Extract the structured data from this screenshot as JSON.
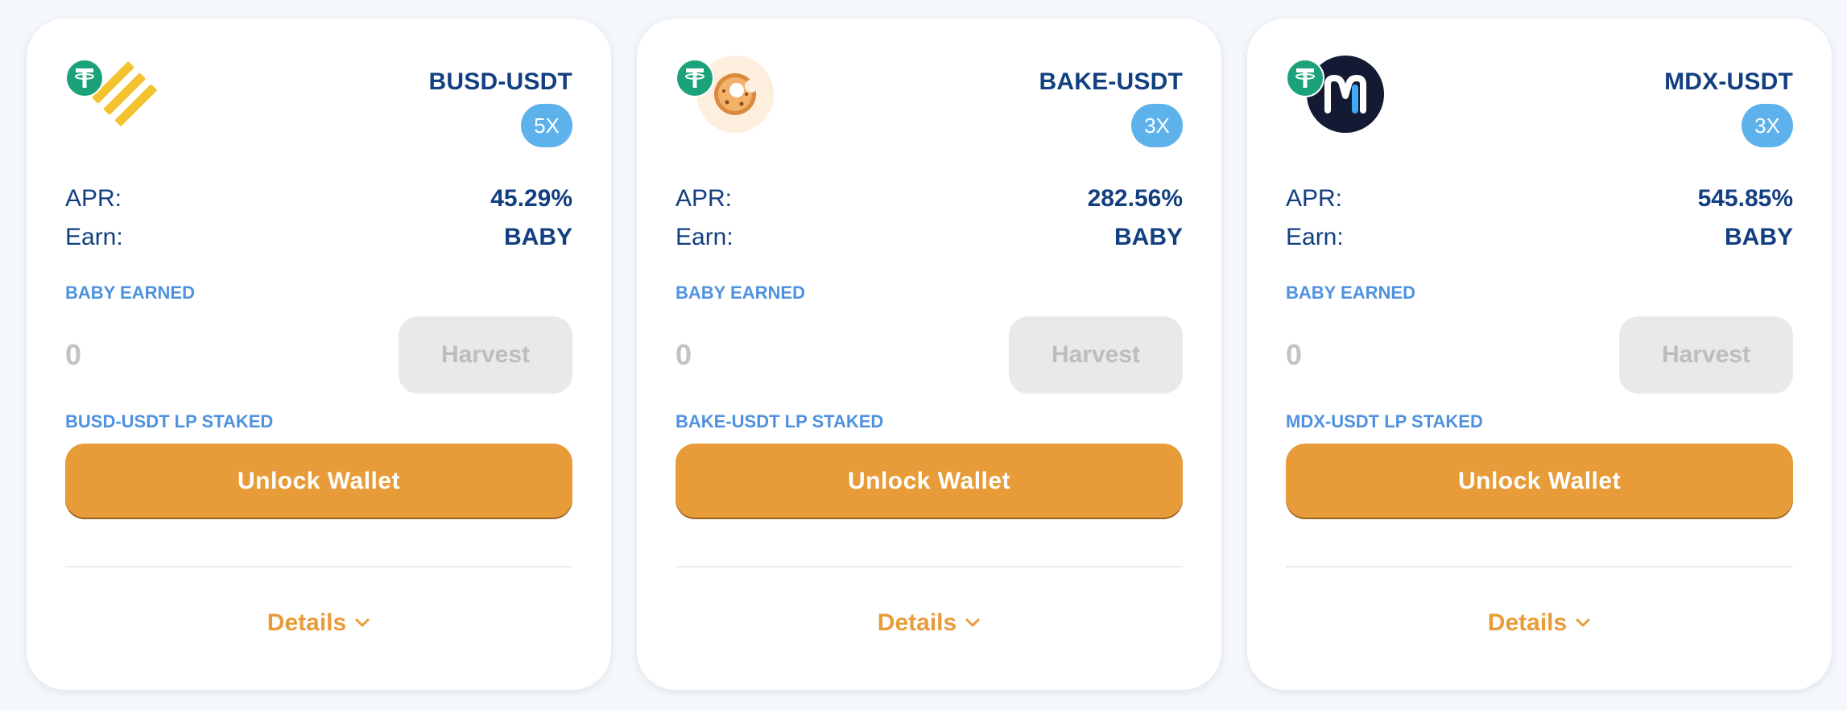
{
  "farms": [
    {
      "pair": "BUSD-USDT",
      "multiplier": "5X",
      "apr_label": "APR:",
      "apr": "45.29%",
      "earn_label": "Earn:",
      "earn": "BABY",
      "earned_label": "BABY EARNED",
      "earned_value": "0",
      "harvest_label": "Harvest",
      "staked_label": "BUSD-USDT LP STAKED",
      "unlock_label": "Unlock Wallet",
      "details_label": "Details",
      "token_icon": "busd-icon",
      "quote_icon": "usdt-icon"
    },
    {
      "pair": "BAKE-USDT",
      "multiplier": "3X",
      "apr_label": "APR:",
      "apr": "282.56%",
      "earn_label": "Earn:",
      "earn": "BABY",
      "earned_label": "BABY EARNED",
      "earned_value": "0",
      "harvest_label": "Harvest",
      "staked_label": "BAKE-USDT LP STAKED",
      "unlock_label": "Unlock Wallet",
      "details_label": "Details",
      "token_icon": "bake-icon",
      "quote_icon": "usdt-icon"
    },
    {
      "pair": "MDX-USDT",
      "multiplier": "3X",
      "apr_label": "APR:",
      "apr": "545.85%",
      "earn_label": "Earn:",
      "earn": "BABY",
      "earned_label": "BABY EARNED",
      "earned_value": "0",
      "harvest_label": "Harvest",
      "staked_label": "MDX-USDT LP STAKED",
      "unlock_label": "Unlock Wallet",
      "details_label": "Details",
      "token_icon": "mdx-icon",
      "quote_icon": "usdt-icon"
    }
  ],
  "colors": {
    "primary_text": "#123f80",
    "label_blue": "#4e92df",
    "multiplier_bg": "#5eb2ec",
    "accent_orange": "#e89c39",
    "usdt_green": "#1ba27a"
  }
}
